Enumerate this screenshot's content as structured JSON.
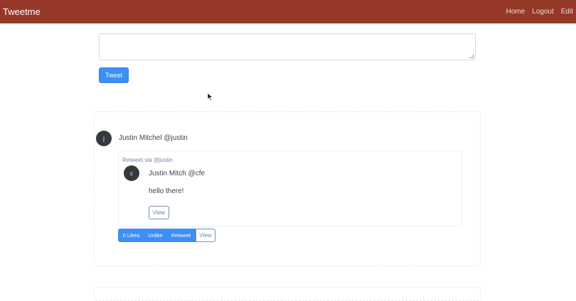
{
  "navbar": {
    "brand": "Tweetme",
    "links": [
      "Home",
      "Logout",
      "Edit"
    ],
    "bg_color": "#963828"
  },
  "compose": {
    "value": "",
    "button_label": "Tweet"
  },
  "feed": [
    {
      "avatar_initial": "j",
      "author": "Justin Mitchel @justin",
      "retweet": {
        "label": "Retweet via @justin",
        "avatar_initial": "c",
        "author": "Justin Mitch @cfe",
        "content": "hello there!",
        "view_label": "View"
      },
      "actions": {
        "likes_label": "0 Likes",
        "unlike_label": "Unlike",
        "retweet_label": "Retweet",
        "view_label": "View"
      }
    }
  ],
  "colors": {
    "primary": "#3d8ff5",
    "muted_link": "#6b86b3"
  }
}
